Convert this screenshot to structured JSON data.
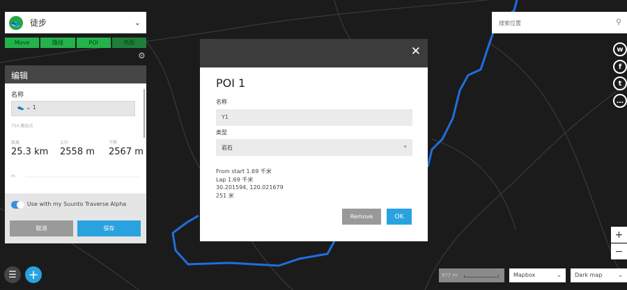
{
  "sport": {
    "label": "徒步",
    "icon": "shoe-icon"
  },
  "tabs": [
    "Move",
    "路线",
    "POI",
    "热图"
  ],
  "edit_panel": {
    "title": "编辑",
    "name_label": "名称",
    "name_value": "1",
    "waypoints": "754 路径点",
    "stats": [
      {
        "label": "距离",
        "value": "25.3 km"
      },
      {
        "label": "上升",
        "value": "2558 m"
      },
      {
        "label": "下降",
        "value": "2567 m"
      }
    ],
    "chart_unit": "m",
    "toggle_label": "Use with my Suunto Traverse Alpha",
    "toggle_on": true,
    "cancel": "取消",
    "save": "保存"
  },
  "modal": {
    "title": "POI 1",
    "name_label": "名称",
    "name_value": "Y1",
    "type_label": "类型",
    "type_value": "岩石",
    "info": [
      "From start 1.69 千米",
      "Lap 1.69 千米",
      "30.201594, 120.021679",
      "251 米"
    ],
    "remove": "Remove",
    "ok": "OK",
    "close": "✕"
  },
  "search": {
    "placeholder": "搜索位置"
  },
  "social": [
    "weibo-icon",
    "facebook-icon",
    "twitter-icon",
    "more-icon"
  ],
  "zoom": {
    "in": "+",
    "out": "−"
  },
  "map": {
    "scale": "977 m",
    "provider": "Mapbox",
    "style": "Dark map"
  },
  "colors": {
    "route": "#1f6fe0",
    "green": "#22b34a",
    "blue": "#2aa2e0"
  }
}
